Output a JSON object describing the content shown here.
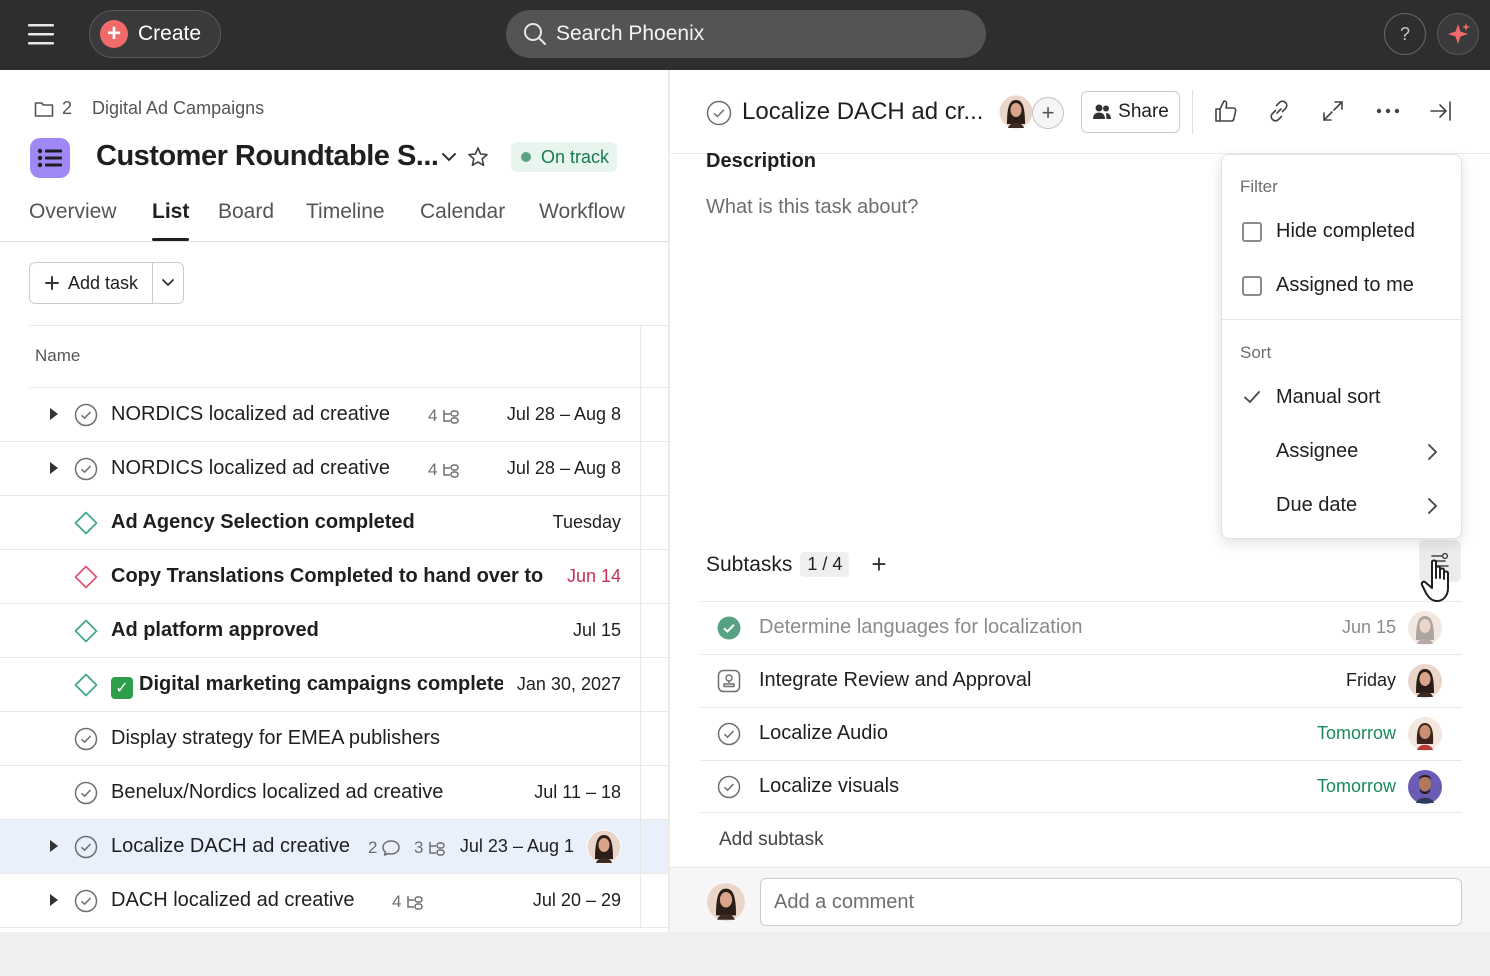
{
  "topbar": {
    "create_label": "Create",
    "search_placeholder": "Search Phoenix",
    "help_label": "?"
  },
  "project": {
    "breadcrumb_count": "2",
    "breadcrumb_name": "Digital Ad Campaigns",
    "title": "Customer Roundtable S...",
    "status": "On track",
    "accent": "#9f87f5"
  },
  "tabs": [
    {
      "label": "Overview"
    },
    {
      "label": "List"
    },
    {
      "label": "Board"
    },
    {
      "label": "Timeline"
    },
    {
      "label": "Calendar"
    },
    {
      "label": "Workflow"
    }
  ],
  "toolbar": {
    "add_task_label": "Add task"
  },
  "list": {
    "name_header": "Name",
    "rows": [
      {
        "name": "NORDICS localized ad creative",
        "subtasks": "4",
        "date": "Jul 28 – Aug 8"
      },
      {
        "name": "NORDICS localized ad creative",
        "subtasks": "4",
        "date": "Jul 28 – Aug 8"
      },
      {
        "name": "Ad Agency Selection completed",
        "date": "Tuesday"
      },
      {
        "name": "Copy Translations Completed to hand over to",
        "date": "Jun 14"
      },
      {
        "name": "Ad platform approved",
        "date": "Jul 15"
      },
      {
        "name": "Digital marketing campaigns complete",
        "date": "Jan 30, 2027"
      },
      {
        "name": "Display strategy for EMEA publishers",
        "date": ""
      },
      {
        "name": "Benelux/Nordics localized ad creative",
        "date": "Jul 11 – 18"
      },
      {
        "name": "Localize DACH ad creative",
        "comments": "2",
        "subtasks": "3",
        "date": "Jul 23 – Aug 1"
      },
      {
        "name": "DACH localized ad creative",
        "subtasks": "4",
        "date": "Jul 20 – 29"
      }
    ]
  },
  "task": {
    "title": "Localize DACH ad cr...",
    "share_label": "Share",
    "description_label": "Description",
    "description_placeholder": "What is this task about?",
    "subtasks_label": "Subtasks",
    "subtasks_count": "1 / 4",
    "subtasks": [
      {
        "name": "Determine languages for localization",
        "date": "Jun 15",
        "done": true
      },
      {
        "name": "Integrate Review and Approval",
        "date": "Friday"
      },
      {
        "name": "Localize Audio",
        "date": "Tomorrow"
      },
      {
        "name": "Localize visuals",
        "date": "Tomorrow"
      }
    ],
    "add_subtask_label": "Add subtask",
    "comment_placeholder": "Add a comment"
  },
  "menu": {
    "filter_label": "Filter",
    "hide_completed": "Hide completed",
    "assigned_to_me": "Assigned to me",
    "sort_label": "Sort",
    "manual_sort": "Manual sort",
    "assignee": "Assignee",
    "due_date": "Due date"
  }
}
